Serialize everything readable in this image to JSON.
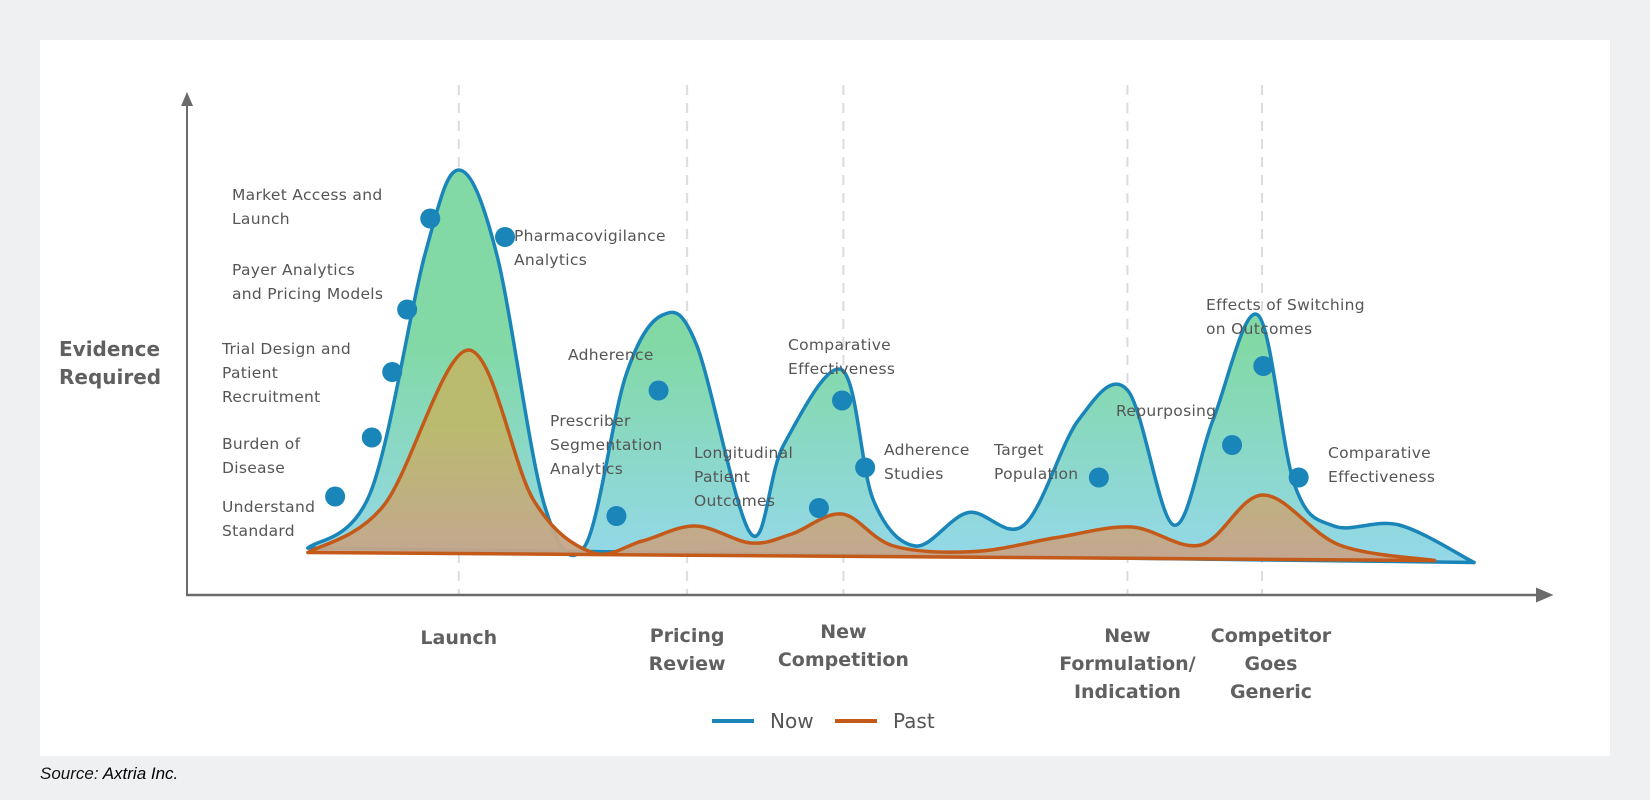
{
  "chart_data": {
    "type": "area",
    "title": "",
    "ylabel": "Evidence Required",
    "xlabel": "",
    "grid": "dashed vertical lines at milestones",
    "legend_position": "bottom-center",
    "x_domain": [
      0,
      100
    ],
    "y_domain": [
      0,
      100
    ],
    "categories": [
      {
        "x": 20.0,
        "lines": [
          "Launch"
        ]
      },
      {
        "x": 36.8,
        "lines": [
          "Pricing",
          "Review"
        ]
      },
      {
        "x": 48.3,
        "lines": [
          "New",
          "Competition"
        ]
      },
      {
        "x": 69.2,
        "lines": [
          "New",
          "Formulation/",
          "Indication"
        ]
      },
      {
        "x": 79.1,
        "lines": [
          "Competitor",
          "Goes",
          "Generic"
        ]
      }
    ],
    "series": [
      {
        "name": "Now",
        "color": "#1a85b8",
        "fill_top": "#82d9a6",
        "fill_bottom": "#94d8ea",
        "points": [
          [
            8.9,
            9.4
          ],
          [
            13.5,
            20.5
          ],
          [
            17.5,
            68
          ],
          [
            20.0,
            85
          ],
          [
            22.8,
            68
          ],
          [
            26.3,
            18
          ],
          [
            29.3,
            9.9
          ],
          [
            32.3,
            44
          ],
          [
            35.0,
            56
          ],
          [
            37.5,
            50
          ],
          [
            41.5,
            12.2
          ],
          [
            43.9,
            30
          ],
          [
            48.2,
            45
          ],
          [
            50.5,
            19
          ],
          [
            53.6,
            9.8
          ],
          [
            57.5,
            16.5
          ],
          [
            61.6,
            14
          ],
          [
            65.6,
            35
          ],
          [
            69.2,
            41
          ],
          [
            72.6,
            14
          ],
          [
            75.5,
            35
          ],
          [
            78.8,
            56
          ],
          [
            81.5,
            22
          ],
          [
            84.4,
            13.8
          ],
          [
            89.2,
            14
          ],
          [
            94.7,
            6.5
          ]
        ],
        "baseline_from": [
          8.9,
          9.4
        ],
        "baseline_to": [
          94.7,
          6.5
        ]
      },
      {
        "name": "Past",
        "color": "#c45a1a",
        "fill_top": "#bdb96a",
        "fill_bottom": "#c6a48c",
        "points": [
          [
            8.9,
            8.5
          ],
          [
            14.5,
            18
          ],
          [
            20.7,
            49
          ],
          [
            25.5,
            19
          ],
          [
            29.8,
            8.5
          ],
          [
            33.5,
            10.8
          ],
          [
            37.4,
            13.8
          ],
          [
            41.5,
            10.4
          ],
          [
            44.5,
            12.2
          ],
          [
            48.2,
            16.2
          ],
          [
            52.0,
            9.8
          ],
          [
            58.0,
            8.7
          ],
          [
            64.0,
            11.5
          ],
          [
            69.5,
            13.6
          ],
          [
            74.6,
            10.0
          ],
          [
            79.2,
            20.0
          ],
          [
            84.8,
            10.0
          ],
          [
            91.8,
            6.9
          ]
        ],
        "baseline_from": [
          8.9,
          8.5
        ],
        "baseline_to": [
          91.8,
          6.9
        ]
      }
    ],
    "markers": [
      {
        "series": "Now",
        "x": 10.9,
        "y": 19.7,
        "label": [
          "Understand",
          "Standard"
        ],
        "label_anchor": "left"
      },
      {
        "series": "Now",
        "x": 13.6,
        "y": 31.5,
        "label": [
          "Burden of",
          "Disease"
        ],
        "label_anchor": "left"
      },
      {
        "series": "Now",
        "x": 15.1,
        "y": 44.6,
        "label": [
          "Trial Design and",
          "Patient",
          "Recruitment"
        ],
        "label_anchor": "left"
      },
      {
        "series": "Now",
        "x": 16.2,
        "y": 57.1,
        "label": [
          "Payer Analytics",
          "and Pricing Models"
        ],
        "label_anchor": "left"
      },
      {
        "series": "Now",
        "x": 17.9,
        "y": 75.3,
        "label": [
          "Market Access and",
          "Launch"
        ],
        "label_anchor": "left"
      },
      {
        "series": "Now",
        "x": 23.4,
        "y": 71.6,
        "label": [
          "Pharmacovigilance",
          "Analytics"
        ],
        "label_anchor": "right"
      },
      {
        "series": "Now",
        "x": 31.6,
        "y": 15.8,
        "label": [
          "Prescriber",
          "Segmentation",
          "Analytics"
        ],
        "label_anchor": "left"
      },
      {
        "series": "Now",
        "x": 34.7,
        "y": 40.9,
        "label": [
          "Adherence"
        ],
        "label_anchor": "left"
      },
      {
        "series": "Now",
        "x": 46.5,
        "y": 17.4,
        "label": [
          "Longitudinal",
          "Patient",
          "Outcomes"
        ],
        "label_anchor": "left"
      },
      {
        "series": "Now",
        "x": 48.2,
        "y": 38.9,
        "label": [
          "Comparative",
          "Effectiveness"
        ],
        "label_anchor": "above"
      },
      {
        "series": "Now",
        "x": 49.9,
        "y": 25.5,
        "label": [
          "Adherence",
          "Studies"
        ],
        "label_anchor": "right"
      },
      {
        "series": "Now",
        "x": 67.1,
        "y": 23.5,
        "label": [
          "Target",
          "Population"
        ],
        "label_anchor": "left"
      },
      {
        "series": "Now",
        "x": 76.9,
        "y": 30.0,
        "label": [
          "Repurposing"
        ],
        "label_anchor": "left"
      },
      {
        "series": "Now",
        "x": 79.2,
        "y": 45.8,
        "label": [
          "Effects of Switching",
          "on Outcomes"
        ],
        "label_anchor": "above"
      },
      {
        "series": "Now",
        "x": 81.8,
        "y": 23.5,
        "label": [
          "Comparative",
          "Effectiveness"
        ],
        "label_anchor": "right"
      }
    ],
    "legend": [
      {
        "name": "Now",
        "color": "#1a85b8"
      },
      {
        "name": "Past",
        "color": "#c45a1a"
      }
    ]
  },
  "source": {
    "label": "Source:",
    "org": "Axtria Inc."
  },
  "colors": {
    "background": "#eff0f2",
    "card": "#ffffff",
    "axis": "#6b6b6b",
    "grid": "#dcdcdc",
    "marker": "#1a85b8"
  }
}
